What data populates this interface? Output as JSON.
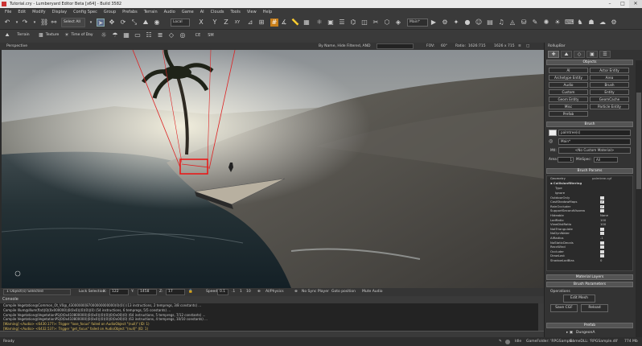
{
  "titlebar": {
    "title": "Tutorial.cry - Lumberyard Editor Beta [x64] - Build 3582"
  },
  "menu": [
    "File",
    "Edit",
    "Modify",
    "Display",
    "Config Spec",
    "Group",
    "Prefabs",
    "Terrain",
    "Audio",
    "Game",
    "AI",
    "Clouds",
    "Tools",
    "View",
    "Help"
  ],
  "toolbar": {
    "select_all": "Select All",
    "coord_system": "Local",
    "axis_x": "X",
    "axis_y": "Y",
    "axis_z": "Z",
    "axis_xy": "XY",
    "main_layer": "Main*"
  },
  "toolbar2": {
    "terrain": "Terrain",
    "texture": "Texture",
    "time_of_day": "Time of Day",
    "ce": "CE",
    "sm": "SM"
  },
  "viewport": {
    "name": "Perspective",
    "filter": "By Name, Hide Filtered, AND",
    "fov_label": "FOV:",
    "fov_value": "60°",
    "ratio_label": "Ratio:",
    "ratio_value": "1626:715",
    "resolution": "1626 x 715"
  },
  "status": {
    "selected": "1 Object(s) Selected",
    "lock_selection": "Lock Selection",
    "x_label": "X:",
    "x_value": "122",
    "y_label": "Y:",
    "y_value": "1458",
    "z_label": "Z:",
    "z_value": "17",
    "speed_label": "Speed:",
    "speed_value": "0.1",
    "speed_a": ".1",
    "speed_b": "1",
    "speed_c": "10",
    "ai_physics": "AI/Physics",
    "no_sync": "No Sync Player",
    "goto_position": "Goto position",
    "mute_audio": "Mute Audio"
  },
  "console": {
    "title": "Console",
    "lines": [
      "Compile Vegetation@Common_Ot_V0@_43000000[87000000000000(0)(0)] (13 instructions, 2 tempregs, 3/8 constants) ...",
      "Compile Illum@Illum(flat)|0|(0x000000)|0(0x0)|(0)(0)|(0) (54 instructions, 6 tempregs, 5/5 constants) ...",
      "Compile Vegetation@VegetationPS|0(0x410800000)|0(0x0)|(0)(0)|0(0x00)(0) (64 instructions, 5 tempregs, 7/12 constants) ...",
      "Compile Vegetation@VegetationPS|0(0x410800000)|0(0x0)|(0)(0)|0(0x00)(0) (63 instructions, 4 tempregs, 10/10 constants) ...",
      "[Warning] <Audio> <6430.177>: Trigger \"lose_focus\" failed on AudioObject \"(null)\" (ID: 1)",
      "[Warning] <Audio> <6432.537>: Trigger \"get_focus\" failed on AudioObject \"(null)\" (ID: 1)"
    ]
  },
  "bottombar": {
    "ready": "Ready",
    "idle": "Idle",
    "gamefolder": "GameFolder: 'RPGSample'",
    "gamedll": "GameDLL: 'RPGSample.dll'",
    "memory": "774 Mb"
  },
  "rollup": {
    "title": "RollupBar",
    "objects_header": "Objects",
    "objects": [
      "AI",
      "Actor Entity",
      "Archetype Entity",
      "Area",
      "Audio",
      "Brush",
      "Custom",
      "Entity",
      "Geom Entity",
      "GeomCache",
      "Misc",
      "Particle Entity",
      "Prefab"
    ],
    "brush_header": "Brush",
    "brush_name": "palmtree(s)",
    "brush_layer": "Main*",
    "mtl_label": "Mtl:",
    "mtl_value": "<No Custom Material>",
    "area_label": "Area:",
    "area_value": "1",
    "minspec_label": "MinSpec:",
    "minspec_value": "All",
    "params_header": "Brush Params",
    "geometry_label": "Geometry",
    "geometry_value": "palmtree.cgf",
    "collision_label": "Collisionfiltering",
    "params": [
      {
        "label": "Type",
        "value": ""
      },
      {
        "label": "Ignore",
        "value": ""
      },
      {
        "label": "OutdoorOnly",
        "value": "check"
      },
      {
        "label": "CastShadowMaps",
        "value": "checked"
      },
      {
        "label": "RainOccluder",
        "value": "checked"
      },
      {
        "label": "SupportSecondVisarea",
        "value": "check"
      },
      {
        "label": "Hideable",
        "value": "None"
      },
      {
        "label": "LodRatio",
        "value": "100"
      },
      {
        "label": "ViewDistRatio",
        "value": "100"
      },
      {
        "label": "NotTriangulate",
        "value": "check"
      },
      {
        "label": "NoDynWater",
        "value": "check"
      },
      {
        "label": "AIRadius",
        "value": "-1"
      },
      {
        "label": "NoStaticDecals",
        "value": "check"
      },
      {
        "label": "RecvWind",
        "value": "check"
      },
      {
        "label": "Occluder",
        "value": "check"
      },
      {
        "label": "DrawLast",
        "value": "check"
      },
      {
        "label": "ShadowLodBias",
        "value": "0"
      }
    ],
    "material_layers": "Material Layers",
    "brush_parameters": "Brush Parameters",
    "operations": "Operations",
    "edit_mesh": "Edit Mesh",
    "save_cgf": "Save CGF",
    "reload": "Reload",
    "prefab_header": "Prefab",
    "prefab_item": "DungeonA"
  }
}
